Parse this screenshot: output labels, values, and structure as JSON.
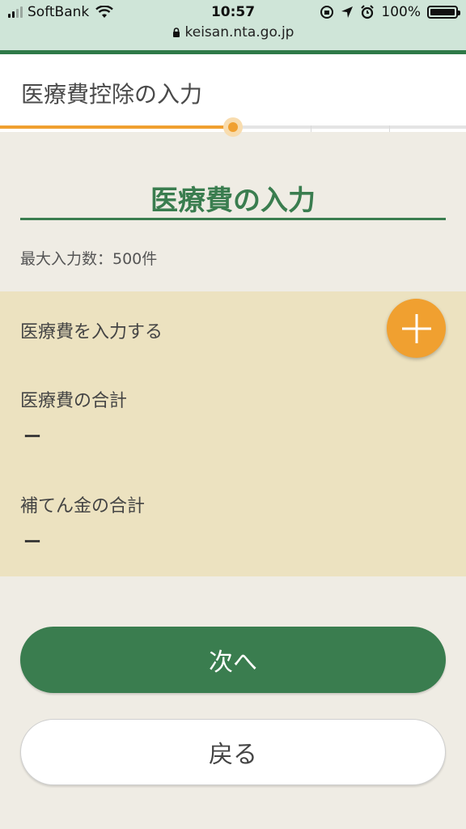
{
  "status_bar": {
    "carrier": "SoftBank",
    "time": "10:57",
    "battery": "100%",
    "url": "keisan.nta.go.jp"
  },
  "header": {
    "title": "医療費控除の入力"
  },
  "progress": {
    "fraction": 0.5
  },
  "section": {
    "title": "医療費の入力",
    "max_count": "最大入力数：500件"
  },
  "panel": {
    "add_label": "医療費を入力する",
    "medical_total_label": "医療費の合計",
    "medical_total_value": "ー",
    "subsidy_total_label": "補てん金の合計",
    "subsidy_total_value": "ー"
  },
  "buttons": {
    "next": "次へ",
    "back": "戻る"
  },
  "colors": {
    "brand_green": "#3a7d4f",
    "accent_orange": "#f0a030",
    "panel_bg": "#ece2c0",
    "page_bg": "#efece4"
  }
}
